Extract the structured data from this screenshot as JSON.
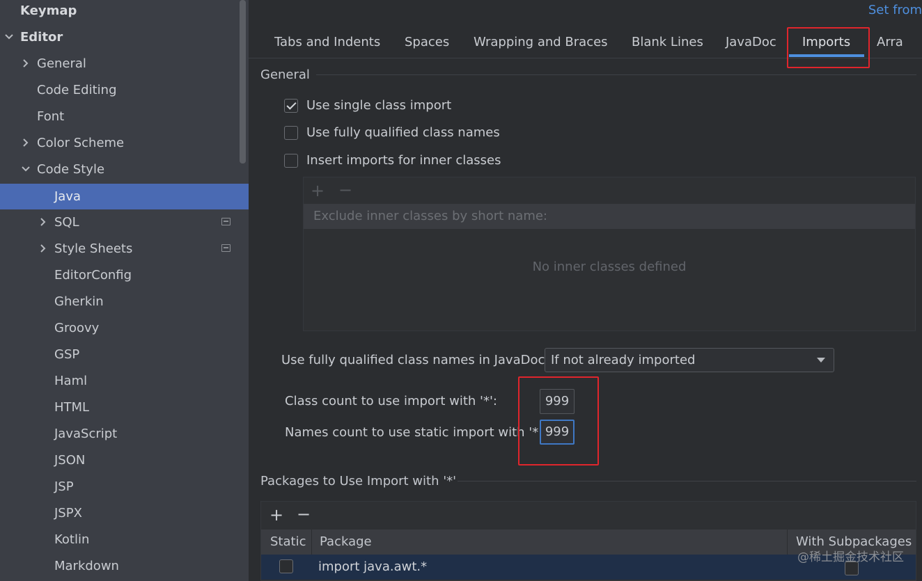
{
  "sidebar": {
    "keymap": "Keymap",
    "editor": "Editor",
    "items": [
      {
        "label": "General"
      },
      {
        "label": "Code Editing"
      },
      {
        "label": "Font"
      },
      {
        "label": "Color Scheme"
      },
      {
        "label": "Code Style"
      },
      {
        "label": "Java"
      },
      {
        "label": "SQL"
      },
      {
        "label": "Style Sheets"
      },
      {
        "label": "EditorConfig"
      },
      {
        "label": "Gherkin"
      },
      {
        "label": "Groovy"
      },
      {
        "label": "GSP"
      },
      {
        "label": "Haml"
      },
      {
        "label": "HTML"
      },
      {
        "label": "JavaScript"
      },
      {
        "label": "JSON"
      },
      {
        "label": "JSP"
      },
      {
        "label": "JSPX"
      },
      {
        "label": "Kotlin"
      },
      {
        "label": "Markdown"
      }
    ]
  },
  "header": {
    "set_from": "Set from"
  },
  "tabs": [
    {
      "label": "Tabs and Indents"
    },
    {
      "label": "Spaces"
    },
    {
      "label": "Wrapping and Braces"
    },
    {
      "label": "Blank Lines"
    },
    {
      "label": "JavaDoc"
    },
    {
      "label": "Imports"
    },
    {
      "label": "Arra"
    }
  ],
  "general": {
    "title": "General",
    "single_class_import": "Use single class import",
    "fully_qualified": "Use fully qualified class names",
    "inner_classes": "Insert imports for inner classes",
    "exclude_header": "Exclude inner classes by short name:",
    "no_inner": "No inner classes defined"
  },
  "javadoc": {
    "label": "Use fully qualified class names in JavaDoc:",
    "value": "If not already imported"
  },
  "counts": {
    "class_label": "Class count to use import with '*':",
    "class_value": "999",
    "names_label": "Names count to use static import with '*':",
    "names_value": "999"
  },
  "packages": {
    "title": "Packages to Use Import with '*'",
    "col_static": "Static",
    "col_package": "Package",
    "col_sub": "With Subpackages",
    "row_package": "import java.awt.*"
  },
  "watermark": "@稀土掘金技术社区"
}
